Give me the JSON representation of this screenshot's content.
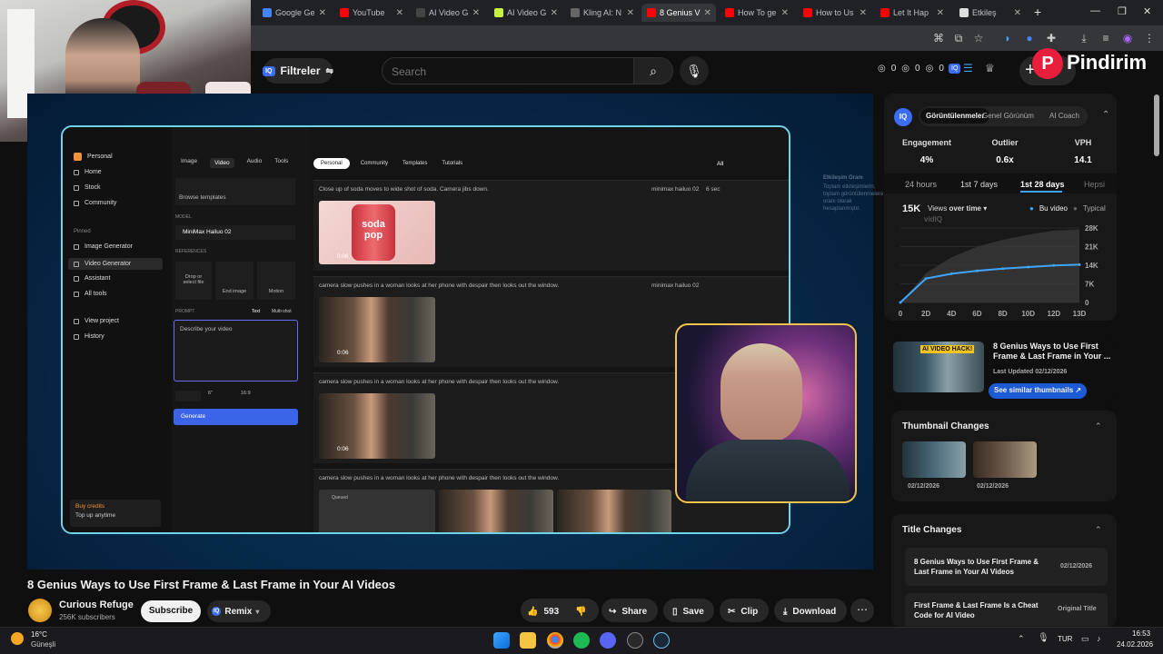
{
  "browser": {
    "tabs": [
      {
        "label": "Google Ge",
        "color": "#4285f4"
      },
      {
        "label": "YouTube",
        "color": "#ff0000"
      },
      {
        "label": "AI Video G",
        "color": "#444444"
      },
      {
        "label": "AI Video G",
        "color": "#c7f043"
      },
      {
        "label": "Kling AI: N",
        "color": "#666666"
      },
      {
        "label": "8 Genius V",
        "color": "#ff0000",
        "active": true
      },
      {
        "label": "How To ge",
        "color": "#ff0000"
      },
      {
        "label": "How to Us",
        "color": "#ff0000"
      },
      {
        "label": "Let It Hap",
        "color": "#ff0000"
      },
      {
        "label": "Etkileş",
        "color": "#dddddd"
      }
    ],
    "new_tab": "+",
    "window_controls": [
      "—",
      "❐",
      "✕"
    ]
  },
  "header": {
    "filters_label": "Filtreler",
    "search_placeholder": "Search",
    "stats": [
      "0",
      "0",
      "0"
    ],
    "watermark": "Pindirim"
  },
  "video": {
    "app": {
      "workspace": "Personal",
      "top_tabs": [
        "Image",
        "Video",
        "Audio",
        "Tools"
      ],
      "sidebar": [
        "Home",
        "Stock",
        "Community"
      ],
      "pinned_label": "Pinned",
      "pinned": [
        "Image Generator",
        "Video Generator",
        "Assistant",
        "All tools"
      ],
      "extra": [
        "View project",
        "History"
      ],
      "buy_credits": "Buy credits",
      "topup": "Top up anytime",
      "browse_templates": "Browse templates",
      "model_label": "MODEL",
      "model_name": "MiniMax Hailuo 02",
      "references_label": "REFERENCES",
      "drop_file": "Drop or select file",
      "end_image": "End image",
      "motion": "Motion",
      "prompt_label": "PROMPT",
      "prompt_modes": [
        "Text",
        "Multi-shot"
      ],
      "prompt_placeholder": "Describe your video",
      "duration_opt": "6\"",
      "ratio_opt": "16:9",
      "generate": "Generate",
      "filters": [
        "Personal",
        "Community",
        "Templates",
        "Tutorials"
      ],
      "filter_all": "All",
      "rows": [
        {
          "prompt": "Close up of soda moves to wide shot of soda. Camera jibs down.",
          "duration": "0:06"
        },
        {
          "prompt": "camera slow pushes in a woman looks at her phone with despair then looks out the window.",
          "duration": "0:06"
        },
        {
          "prompt": "camera slow pushes in a woman looks at her phone with despair then looks out the window.",
          "duration": "0:06"
        },
        {
          "prompt": "camera slow pushes in a woman looks at her phone with despair then looks out the window.",
          "duration": ""
        }
      ],
      "row_meta": [
        "minimax hailuo 02",
        "6 sec",
        "16:9",
        "+1",
        "Tod"
      ],
      "queued": "Queued",
      "soda_text": "soda pop"
    }
  },
  "right_panel": {
    "tabs": [
      "Görüntülenmeler",
      "Genel Görünüm",
      "AI Coach"
    ],
    "stats": [
      {
        "label": "Engagement",
        "value": "4%"
      },
      {
        "label": "Outlier",
        "value": "0.6x"
      },
      {
        "label": "VPH",
        "value": "14.1"
      }
    ],
    "ranges": [
      "24 hours",
      "1st 7 days",
      "1st 28 days",
      "Hepsi"
    ],
    "active_range": "1st 28 days",
    "views_value": "15K",
    "views_dropdown_a": "Views",
    "views_dropdown_b": "over time",
    "legend": [
      "Bu video",
      "Typical"
    ],
    "brand": "vidIQ",
    "tooltip_title": "Etkileşim Oranı",
    "tooltip_body": "Toplam etkileşimlerin, toplam görüntülenmelere oranı olarak hesaplanmıştır.",
    "similar_title": "8 Genius Ways to Use First Frame & Last Frame in Your ...",
    "last_updated": "Last Updated 02/12/2026",
    "similar_button": "See similar thumbnails",
    "thumb_badge": "AI VIDEO HACK!",
    "thumbnail_changes_title": "Thumbnail Changes",
    "thumbnail_dates": [
      "02/12/2026",
      "02/12/2026"
    ],
    "title_changes_title": "Title Changes",
    "title_changes": [
      {
        "title": "8 Genius Ways to Use First Frame & Last Frame in Your AI Videos",
        "date": "02/12/2026"
      },
      {
        "title": "First Frame & Last Frame Is a Cheat Code for AI Video",
        "date": "Original Title"
      }
    ]
  },
  "chart_data": {
    "type": "line",
    "x": [
      "0",
      "2D",
      "4D",
      "6D",
      "8D",
      "10D",
      "12D",
      "13D"
    ],
    "y_ticks": [
      "28K",
      "21K",
      "14K",
      "7K",
      "0"
    ],
    "series": [
      {
        "name": "Bu video",
        "values": [
          0,
          9000,
          10800,
          11900,
          12700,
          13300,
          13900,
          14200
        ],
        "color": "#3ea6ff"
      },
      {
        "name": "Typical",
        "values": [
          0,
          11000,
          17000,
          21000,
          23500,
          25500,
          27000,
          27500
        ],
        "color": "#555555"
      }
    ],
    "ylim": [
      0,
      28000
    ]
  },
  "watch": {
    "title": "8 Genius Ways to Use First Frame & Last Frame in Your AI Videos",
    "channel": "Curious Refuge",
    "subscribers": "256K subscribers",
    "subscribe": "Subscribe",
    "remix": "Remix",
    "likes": "593",
    "share": "Share",
    "save": "Save",
    "clip": "Clip",
    "download": "Download"
  },
  "taskbar": {
    "weather_temp": "16°C",
    "weather_text": "Güneşli",
    "lang": "TUR",
    "time": "16:53",
    "date": "24.02.2026"
  }
}
